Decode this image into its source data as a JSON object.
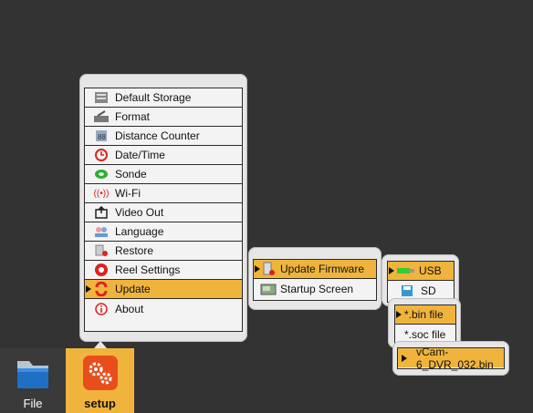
{
  "main_menu": {
    "items": [
      {
        "label": "Default Storage",
        "icon": "storage-icon"
      },
      {
        "label": "Format",
        "icon": "format-icon"
      },
      {
        "label": "Distance Counter",
        "icon": "distance-counter-icon"
      },
      {
        "label": "Date/Time",
        "icon": "clock-icon"
      },
      {
        "label": "Sonde",
        "icon": "sonde-icon"
      },
      {
        "label": "Wi-Fi",
        "icon": "wifi-icon"
      },
      {
        "label": "Video Out",
        "icon": "video-out-icon"
      },
      {
        "label": "Language",
        "icon": "language-icon"
      },
      {
        "label": "Restore",
        "icon": "restore-icon"
      },
      {
        "label": "Reel Settings",
        "icon": "reel-settings-icon"
      },
      {
        "label": "Update",
        "icon": "update-icon",
        "selected": true
      },
      {
        "label": "About",
        "icon": "about-icon"
      }
    ]
  },
  "update_menu": {
    "items": [
      {
        "label": "Update Firmware",
        "icon": "firmware-icon",
        "selected": true
      },
      {
        "label": "Startup Screen",
        "icon": "startup-screen-icon"
      }
    ]
  },
  "source_menu": {
    "items": [
      {
        "label": "USB",
        "icon": "usb-icon",
        "selected": true
      },
      {
        "label": "SD",
        "icon": "sd-card-icon"
      }
    ]
  },
  "filetype_menu": {
    "items": [
      {
        "label": "*.bin file",
        "selected": true
      },
      {
        "label": "*.soc file"
      }
    ]
  },
  "file_menu": {
    "items": [
      {
        "label": "vCam-6_DVR_032.bin",
        "selected": true
      }
    ]
  },
  "taskbar": {
    "file_label": "File",
    "setup_label": "setup"
  },
  "colors": {
    "background": "#333333",
    "highlight": "#f0b43c",
    "panel": "#e6e6e6"
  }
}
